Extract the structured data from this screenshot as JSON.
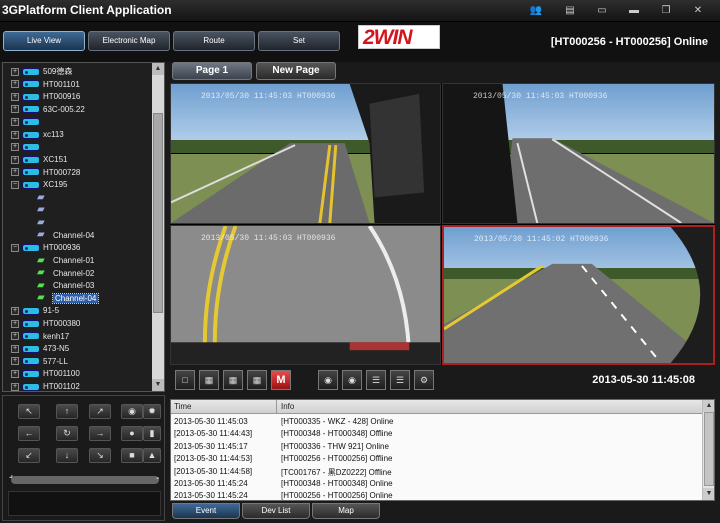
{
  "window": {
    "title": "3GPlatform Client Application"
  },
  "nav": {
    "items": [
      "Live View",
      "Electronic Map",
      "Route",
      "Set"
    ],
    "active": 0
  },
  "logo": {
    "text": "2WIN"
  },
  "status": {
    "text": "[HT000256 - HT000256] Online"
  },
  "tree": {
    "vehicles": [
      {
        "label": "509德森",
        "online": false,
        "expanded": false
      },
      {
        "label": "HT001101",
        "online": false,
        "expanded": false
      },
      {
        "label": "HT000916",
        "online": false,
        "expanded": false
      },
      {
        "label": "63C-005.22",
        "online": false,
        "expanded": false
      },
      {
        "label": "",
        "online": false,
        "expanded": false
      },
      {
        "label": "xc113",
        "online": false,
        "expanded": false
      },
      {
        "label": "",
        "online": false,
        "expanded": false
      },
      {
        "label": "XC151",
        "online": false,
        "expanded": false
      },
      {
        "label": "HT000728",
        "online": false,
        "expanded": false
      },
      {
        "label": "XC195",
        "online": false,
        "expanded": true
      },
      {
        "label": "",
        "channel": true,
        "active": false
      },
      {
        "label": "",
        "channel": true,
        "active": false
      },
      {
        "label": "",
        "channel": true,
        "active": false
      },
      {
        "label": "Channel-04",
        "channel": true,
        "active": false
      },
      {
        "label": "HT000936",
        "online": false,
        "expanded": true
      },
      {
        "label": "Channel-01",
        "channel": true,
        "active": true
      },
      {
        "label": "Channel-02",
        "channel": true,
        "active": true
      },
      {
        "label": "Channel-03",
        "channel": true,
        "active": true
      },
      {
        "label": "Channel-04",
        "channel": true,
        "active": true,
        "selected": true
      },
      {
        "label": "91-5",
        "online": false,
        "expanded": false
      },
      {
        "label": "HT000380",
        "online": false,
        "expanded": false
      },
      {
        "label": "kenh17",
        "online": false,
        "expanded": false
      },
      {
        "label": "473-N5",
        "online": false,
        "expanded": false
      },
      {
        "label": "577-LL",
        "online": false,
        "expanded": false
      },
      {
        "label": "HT001100",
        "online": false,
        "expanded": false
      },
      {
        "label": "HT001102",
        "online": false,
        "expanded": false
      }
    ]
  },
  "pages": {
    "tabs": [
      "Page 1",
      "New Page"
    ],
    "active": 0
  },
  "videos": [
    {
      "osd": "2013/05/30 11:45:03 HT000936"
    },
    {
      "osd": "2013/05/30 11:45:03 HT000936"
    },
    {
      "osd": "2013/05/30 11:45:03 HT000936"
    },
    {
      "osd": "2013/05/30 11:45:02 HT000936",
      "selected": true
    }
  ],
  "toolbar": {
    "highlight_label": "M",
    "clock": "2013-05-30 11:45:08"
  },
  "events": {
    "headers": {
      "time": "Time",
      "info": "Info"
    },
    "rows": [
      {
        "time": "2013-05-30 11:45:03",
        "info": "[HT000335 - WKZ - 428] Online"
      },
      {
        "time": "[2013-05-30 11:44:43]",
        "info": "[HT000348 - HT000348] Offline"
      },
      {
        "time": "2013-05-30 11:45:17",
        "info": "[HT000336 - THW 921] Online"
      },
      {
        "time": "[2013-05-30 11:44:53]",
        "info": "[HT000256 - HT000256] Offline"
      },
      {
        "time": "[2013-05-30 11:44:58]",
        "info": "[TC001767 - 黑DZ0222] Offline"
      },
      {
        "time": "2013-05-30 11:45:24",
        "info": "[HT000348 - HT000348] Online"
      },
      {
        "time": "2013-05-30 11:45:24",
        "info": "[HT000256 - HT000256] Online"
      }
    ]
  },
  "bottom_tabs": {
    "items": [
      "Event",
      "Dev List",
      "Map"
    ],
    "active": 0
  },
  "colors": {
    "accent": "#2d5fa8",
    "online_icon": "#2dbde0",
    "logo_red": "#d4141c",
    "selected_border": "#b01f1f"
  }
}
